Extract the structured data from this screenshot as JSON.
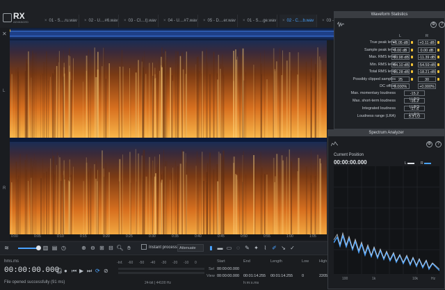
{
  "app": {
    "logo_text": "RX",
    "logo_sub": "ADVANCED"
  },
  "tabs": [
    {
      "label": "01 - S....ru.wav",
      "active": false
    },
    {
      "label": "02 - U....#6.wav",
      "active": false
    },
    {
      "label": "03 - Cl....t).wav",
      "active": false
    },
    {
      "label": "04 - U....#7.wav",
      "active": false
    },
    {
      "label": "05 - D....er.wav",
      "active": false
    },
    {
      "label": "01 - S....ge.wav",
      "active": false
    },
    {
      "label": "02 - C....b.wav",
      "active": true
    },
    {
      "label": "03 - B",
      "active": false
    }
  ],
  "channels": {
    "left": "L",
    "right": "R"
  },
  "timeline_ticks": [
    "0:00",
    "0:05",
    "0:10",
    "0:15",
    "0:20",
    "0:25",
    "0:30",
    "0:35",
    "0:40",
    "0:45",
    "0:50",
    "0:55",
    "1:00",
    "1:05"
  ],
  "toolbar": {
    "instant_process": "Instant process",
    "attenuate": "Attenuate"
  },
  "transport": {
    "filename": "hms.ms",
    "timecode": "00:00:00.000",
    "status": "File opened successfully (91 ms)"
  },
  "meter": {
    "scale": [
      "-Inf.",
      "-60",
      "-50",
      "-40",
      "-30",
      "-20",
      "-10",
      "0"
    ],
    "bitdepth": "24-bit | 44100 Hz"
  },
  "selection": {
    "headers": {
      "start": "Start",
      "end": "End",
      "length": "Length",
      "low": "Low",
      "high": "High"
    },
    "sel_label": "Sel",
    "view_label": "View",
    "sel": {
      "start": "00:00:00.000",
      "end": "",
      "length": ""
    },
    "view": {
      "start": "00:00:00.000",
      "end": "00:01:14.255",
      "length": "00:01:14.255",
      "low": "0",
      "high": "2205"
    },
    "unit": "h:m:s.ms"
  },
  "waveform_statistics": {
    "title": "Waveform Statistics",
    "col_l": "L",
    "col_r": "R",
    "rows": [
      {
        "label": "True peak level",
        "l": "+0.05 dB",
        "r": "+0.11 dB",
        "warn": true
      },
      {
        "label": "Sample peak level",
        "l": "0.00 dB",
        "r": "0.00 dB",
        "warn": true
      },
      {
        "label": "Max. RMS level",
        "l": "-10.98 dB",
        "r": "-11.39 dB",
        "warn": true
      },
      {
        "label": "Min. RMS level",
        "l": "-54.10 dB",
        "r": "-54.59 dB",
        "warn": true
      },
      {
        "label": "Total RMS level",
        "l": "-16.28 dB",
        "r": "-18.21 dB",
        "warn": true
      },
      {
        "label": "Possibly clipped samples",
        "l": "25",
        "r": "30",
        "warn": true
      },
      {
        "label": "DC offset",
        "l": "0.000%",
        "r": "+0.000%",
        "warn": false
      }
    ],
    "loudness": [
      {
        "label": "Max. momentary loudness",
        "value": "-15.2 LUFS"
      },
      {
        "label": "Max. short-term loudness",
        "value": "-16.2 LUFS"
      },
      {
        "label": "Integrated loudness",
        "value": "-17.6 LUFS"
      },
      {
        "label": "Loudness range (LRA)",
        "value": "5.3 LU"
      }
    ]
  },
  "spectrum_analyzer": {
    "title": "Spectrum Analyzer",
    "position_label": "Current Position",
    "position": "00:00:00.000",
    "legend_l": "L",
    "legend_r": "R",
    "x_ticks": [
      "100",
      "1k",
      "10k",
      "Hz"
    ]
  },
  "colors": {
    "accent": "#4aa3ff",
    "spectro_hot": "#f6a23a",
    "spectro_cold": "#1a2d55",
    "warn": "#f3c236"
  }
}
